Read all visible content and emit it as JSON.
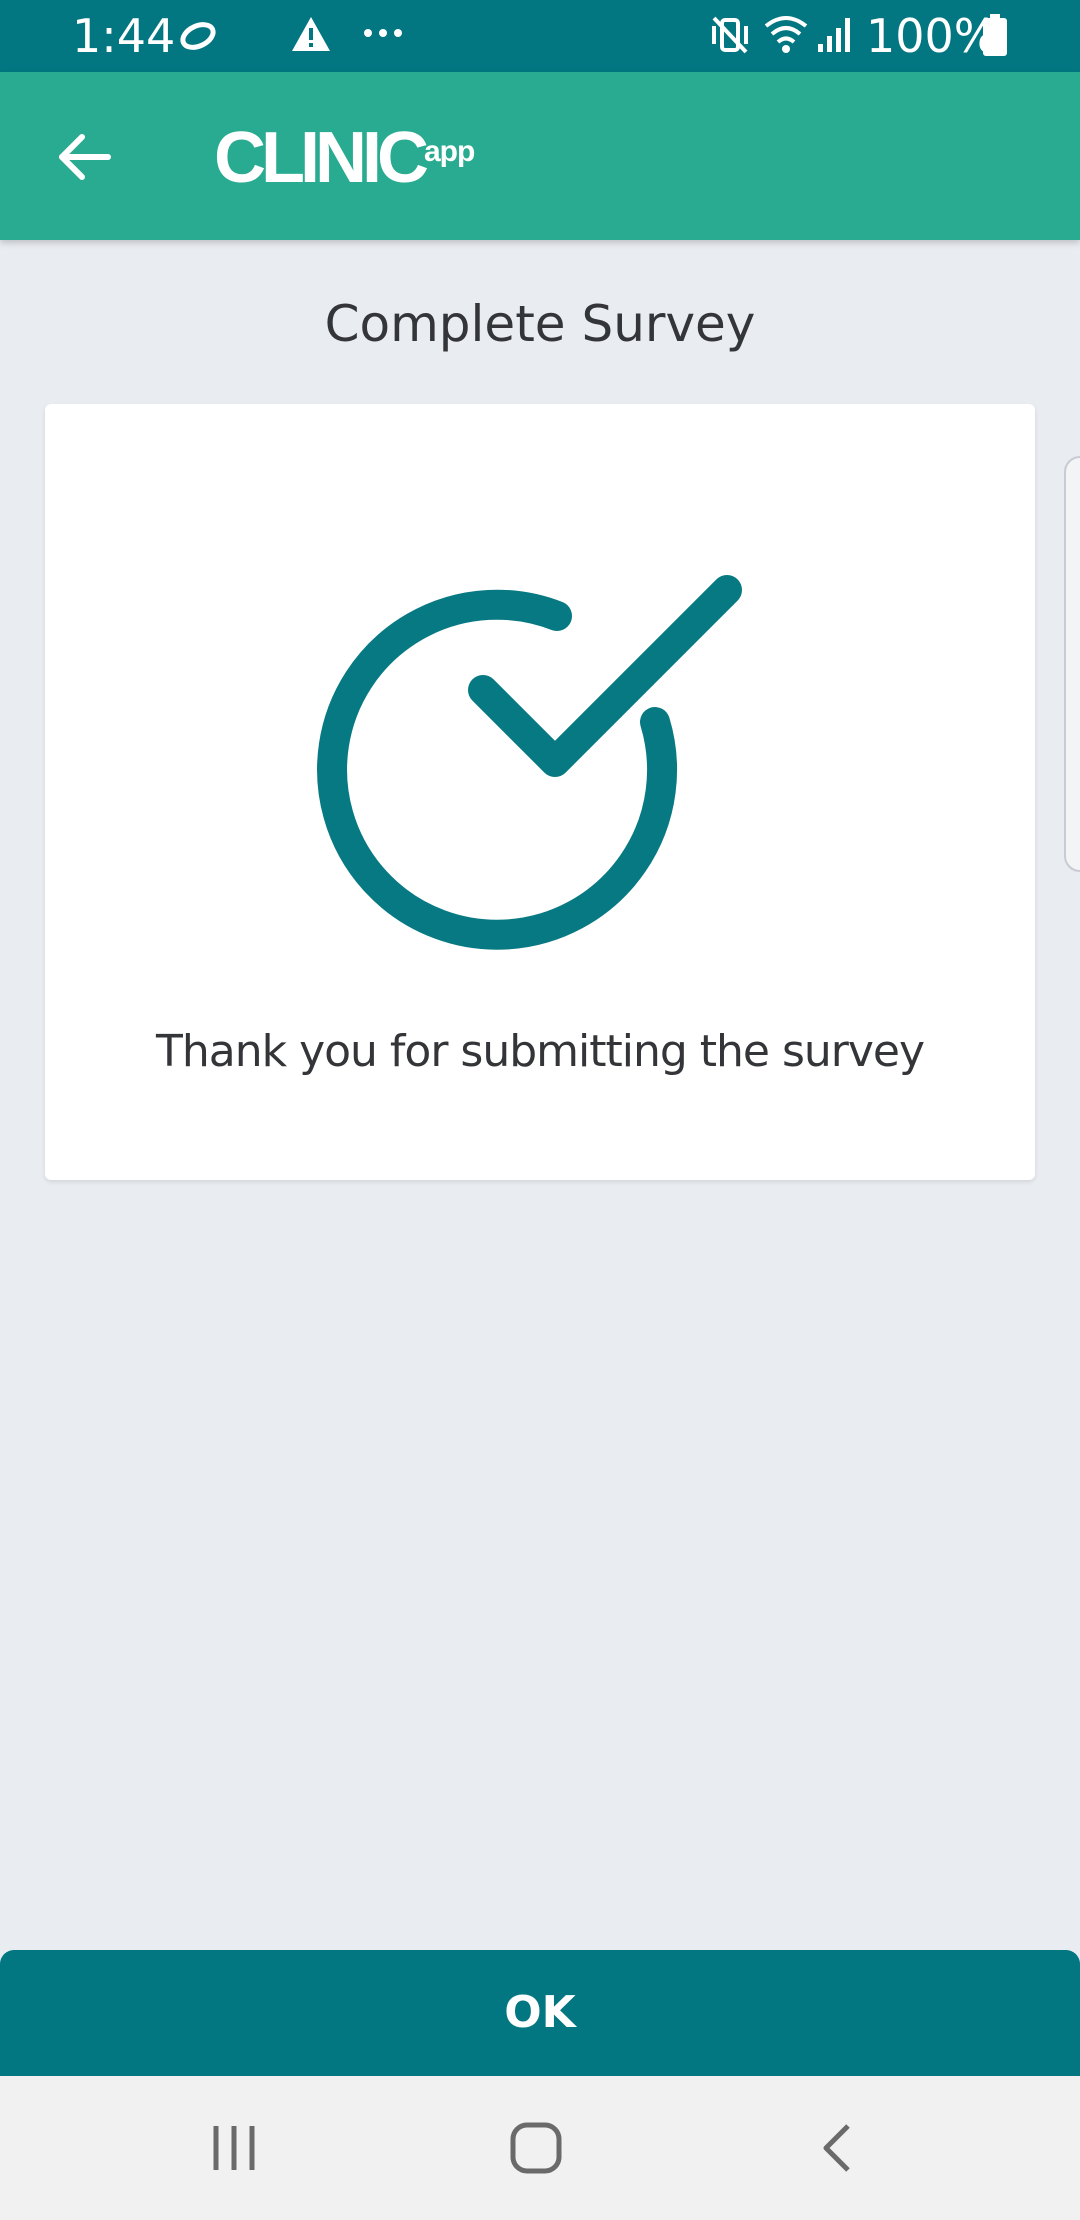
{
  "status_bar": {
    "time": "1:44",
    "battery_percent": "100%",
    "icons": [
      "sync-icon",
      "warning-icon",
      "more-dots-icon",
      "vibrate-icon",
      "wifi-icon",
      "signal-icon",
      "battery-icon"
    ]
  },
  "app_bar": {
    "logo_main": "CLINIC",
    "logo_sub": "app",
    "back_icon": "arrow-left-icon",
    "color": "#28ab90"
  },
  "page": {
    "title": "Complete Survey",
    "message": "Thank you for submitting the survey",
    "success_icon": "check-circle-icon",
    "accent_color": "#077983"
  },
  "actions": {
    "ok_label": "OK"
  },
  "nav_bar": {
    "items": [
      "recent-apps-icon",
      "home-icon",
      "back-icon"
    ]
  }
}
